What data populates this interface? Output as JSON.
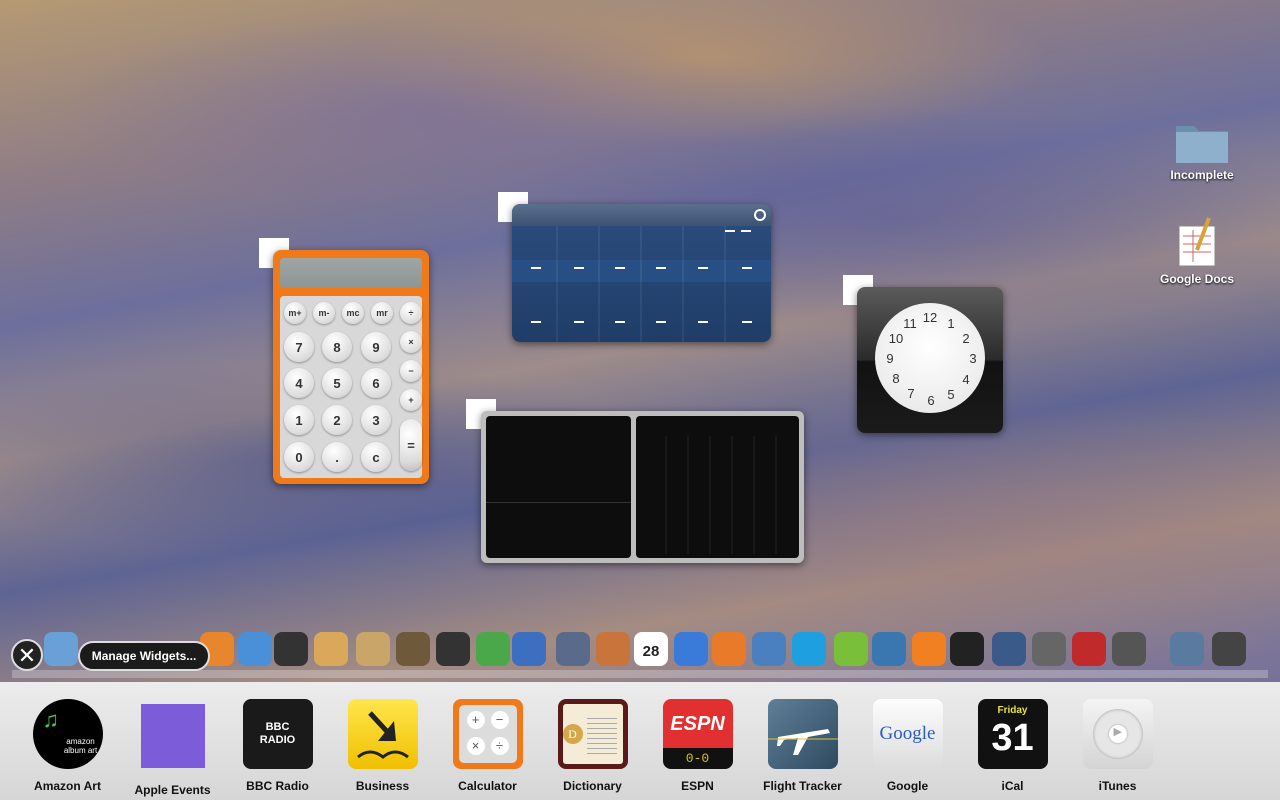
{
  "desktop": {
    "icons": [
      {
        "label": "Incomplete",
        "icon": "folder-icon"
      },
      {
        "label": "Google Docs",
        "icon": "google-docs-icon"
      }
    ]
  },
  "calculator_widget": {
    "memory_keys": [
      "m+",
      "m-",
      "mc",
      "mr"
    ],
    "digit_rows": [
      [
        "7",
        "8",
        "9"
      ],
      [
        "4",
        "5",
        "6"
      ],
      [
        "1",
        "2",
        "3"
      ],
      [
        "0",
        ".",
        "c"
      ]
    ],
    "operators": [
      "÷",
      "×",
      "−",
      "+",
      "="
    ]
  },
  "clock_widget": {
    "numbers": [
      "12",
      "1",
      "2",
      "3",
      "4",
      "5",
      "6",
      "7",
      "8",
      "9",
      "10",
      "11"
    ]
  },
  "controls": {
    "close_symbol": "✕",
    "manage_widgets": "Manage Widgets..."
  },
  "widget_bar": {
    "items": [
      {
        "label": "Amazon Art",
        "icon": "amazon-art-icon",
        "icon_text": "amazon album art"
      },
      {
        "label": "Apple Events",
        "icon": "apple-events-icon"
      },
      {
        "label": "BBC Radio",
        "icon": "bbc-radio-icon",
        "icon_text": "BBC RADIO"
      },
      {
        "label": "Business",
        "icon": "business-icon"
      },
      {
        "label": "Calculator",
        "icon": "calculator-icon"
      },
      {
        "label": "Dictionary",
        "icon": "dictionary-icon"
      },
      {
        "label": "ESPN",
        "icon": "espn-icon",
        "icon_text": "ESPN",
        "score": "0-0"
      },
      {
        "label": "Flight Tracker",
        "icon": "flight-tracker-icon"
      },
      {
        "label": "Google",
        "icon": "google-icon",
        "icon_text": "Google"
      },
      {
        "label": "iCal",
        "icon": "ical-icon",
        "day": "Friday",
        "date": "31"
      },
      {
        "label": "iTunes",
        "icon": "itunes-icon"
      }
    ]
  },
  "dock": {
    "icons": [
      "finder-icon",
      "firefox-icon",
      "itunes-icon",
      "bird-icon",
      "package-icon",
      "address-book-icon",
      "iphoto-icon",
      "aperture-icon",
      "sitemap-icon",
      "word-icon",
      "pen-icon",
      "keynote-icon",
      "ical-icon",
      "ichat-icon",
      "fireball-icon",
      "people-icon",
      "skype-icon",
      "lime-icon",
      "xcode-icon",
      "vlc-icon",
      "clapper-icon",
      "dashboard-icon",
      "system-preferences-icon",
      "windows-icon",
      "recycle-icon",
      "downloads-folder-icon",
      "trash-icon"
    ],
    "ical_date": "28"
  },
  "colors": {
    "calculator_orange": "#f07a1a",
    "table_blue": "#1f3d68",
    "widget_bar": "#e4e4e4"
  }
}
